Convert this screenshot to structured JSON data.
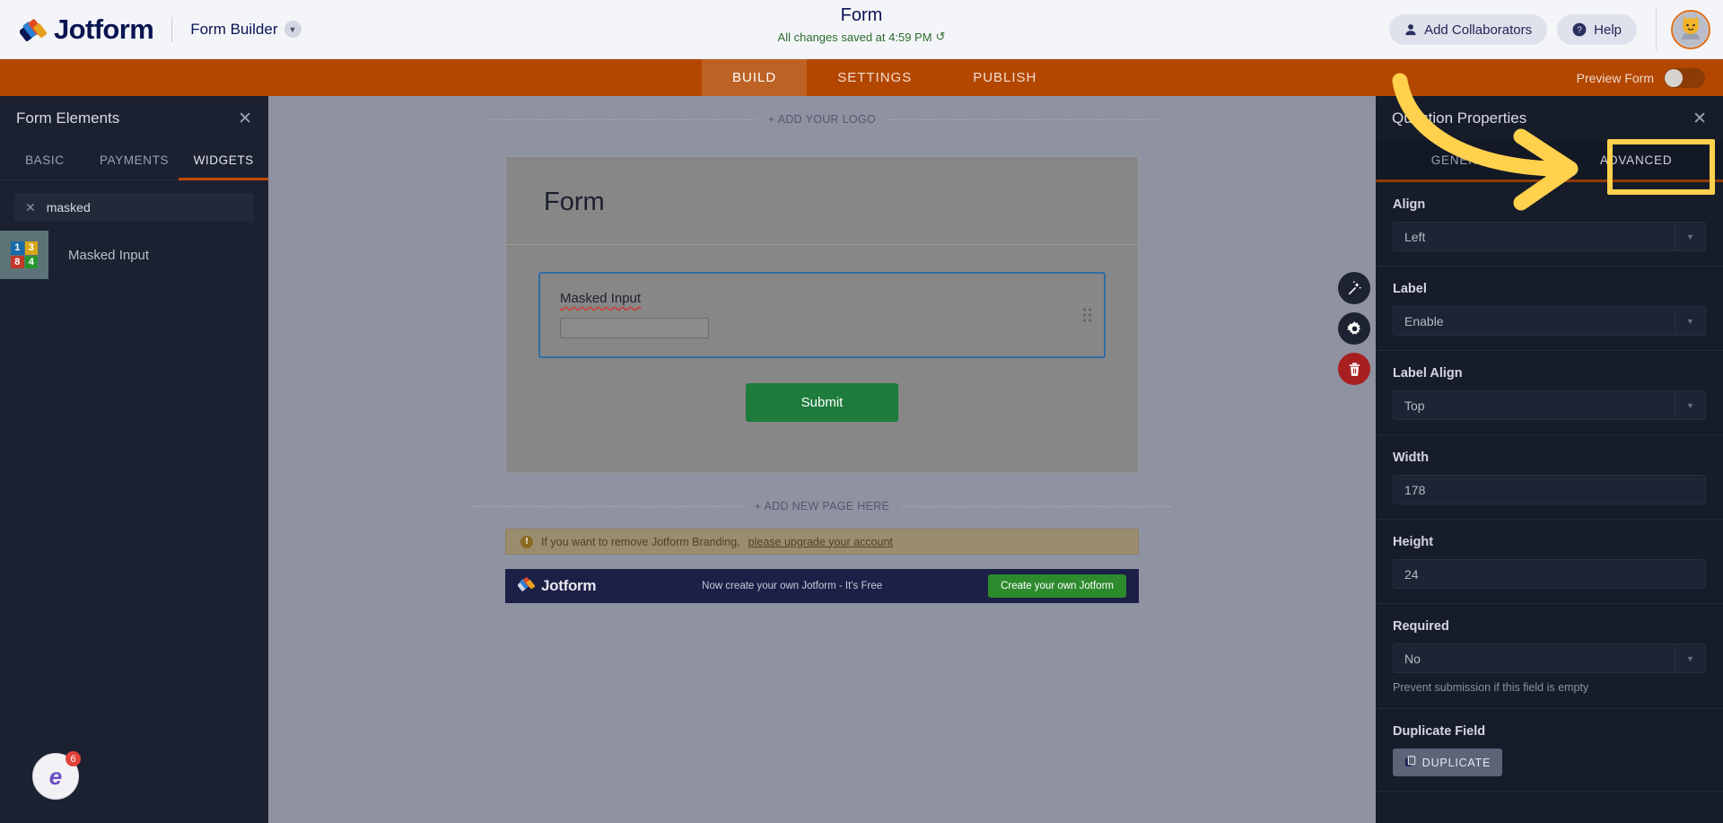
{
  "header": {
    "brand": "Jotform",
    "menu_label": "Form Builder",
    "chevron_icon": "chevron-down-icon",
    "form_title": "Form",
    "saved_status": "All changes saved at 4:59 PM",
    "refresh_icon": "↺",
    "add_collaborators": "Add Collaborators",
    "help": "Help",
    "avatar_icon": "avatar"
  },
  "navbar": {
    "tabs": [
      {
        "label": "BUILD",
        "active": true
      },
      {
        "label": "SETTINGS",
        "active": false
      },
      {
        "label": "PUBLISH",
        "active": false
      }
    ],
    "preview_label": "Preview Form",
    "toggle_state": "off",
    "accent": "#b34700"
  },
  "sidebar": {
    "title": "Form Elements",
    "close_icon": "✕",
    "tabs": [
      {
        "label": "BASIC",
        "active": false
      },
      {
        "label": "PAYMENTS",
        "active": false
      },
      {
        "label": "WIDGETS",
        "active": true
      }
    ],
    "search": {
      "value": "masked",
      "clear_icon": "✕"
    },
    "widgets": [
      {
        "label": "Masked Input",
        "icon": "masked-input-icon",
        "cells": [
          {
            "digit": "1",
            "color": "#1a6aa8"
          },
          {
            "digit": "3",
            "color": "#d8a617"
          },
          {
            "digit": "8",
            "color": "#c0392b"
          },
          {
            "digit": "4",
            "color": "#27962f"
          }
        ]
      }
    ]
  },
  "canvas": {
    "add_logo": "+ ADD YOUR LOGO",
    "form_heading": "Form",
    "field": {
      "label": "Masked Input",
      "input_value": "",
      "drag_handle_icon": "drag-handle-icon"
    },
    "submit_label": "Submit",
    "add_new_page": "+ ADD NEW PAGE HERE",
    "branding_notice_prefix": "If you want to remove Jotform Branding,",
    "branding_notice_link": "please upgrade your account",
    "banner": {
      "brand": "Jotform",
      "message": "Now create your own Jotform - It's Free",
      "cta": "Create your own Jotform"
    },
    "fabs": [
      {
        "name": "magic-wand-icon",
        "style": "dark"
      },
      {
        "name": "gear-icon",
        "style": "dark"
      },
      {
        "name": "trash-icon",
        "style": "red"
      }
    ]
  },
  "properties": {
    "title": "Question Properties",
    "close_icon": "✕",
    "tabs": [
      {
        "label": "GENERAL",
        "active": false
      },
      {
        "label": "ADVANCED",
        "active": true
      }
    ],
    "fields": [
      {
        "label": "Align",
        "value": "Left",
        "type": "select"
      },
      {
        "label": "Label",
        "value": "Enable",
        "type": "select"
      },
      {
        "label": "Label Align",
        "value": "Top",
        "type": "select"
      },
      {
        "label": "Width",
        "value": "178",
        "type": "input"
      },
      {
        "label": "Height",
        "value": "24",
        "type": "input"
      },
      {
        "label": "Required",
        "value": "No",
        "type": "select",
        "hint": "Prevent submission if this field is empty"
      }
    ],
    "duplicate_section_label": "Duplicate Field",
    "duplicate_button": "DUPLICATE",
    "duplicate_icon": "copy-icon"
  },
  "annotations": {
    "highlight_target": "ADVANCED",
    "arrow_color": "#ffd14d",
    "box_color": "#ffd14d"
  },
  "extension_badge": {
    "glyph": "e",
    "count": "6"
  }
}
